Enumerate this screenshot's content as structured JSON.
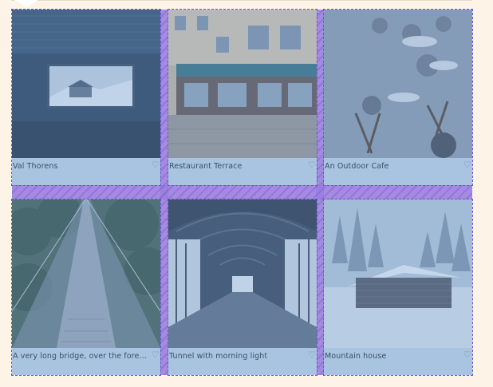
{
  "gallery": {
    "items": [
      {
        "caption": "Val Thorens",
        "icon": "heart-icon"
      },
      {
        "caption": "Restaurant Terrace",
        "icon": "heart-icon"
      },
      {
        "caption": "An Outdoor Cafe",
        "icon": "heart-icon"
      },
      {
        "caption": "A very long bridge, over the forest...",
        "icon": "heart-icon"
      },
      {
        "caption": "Tunnel with morning light",
        "icon": "heart-icon"
      },
      {
        "caption": "Mountain house",
        "icon": "heart-icon"
      }
    ]
  },
  "colors": {
    "page_background": "#fdf3e6",
    "card_overlay": "#a8c4e0",
    "grid_gap_highlight": "#9b7fe0",
    "caption_text": "#3d4f66"
  }
}
